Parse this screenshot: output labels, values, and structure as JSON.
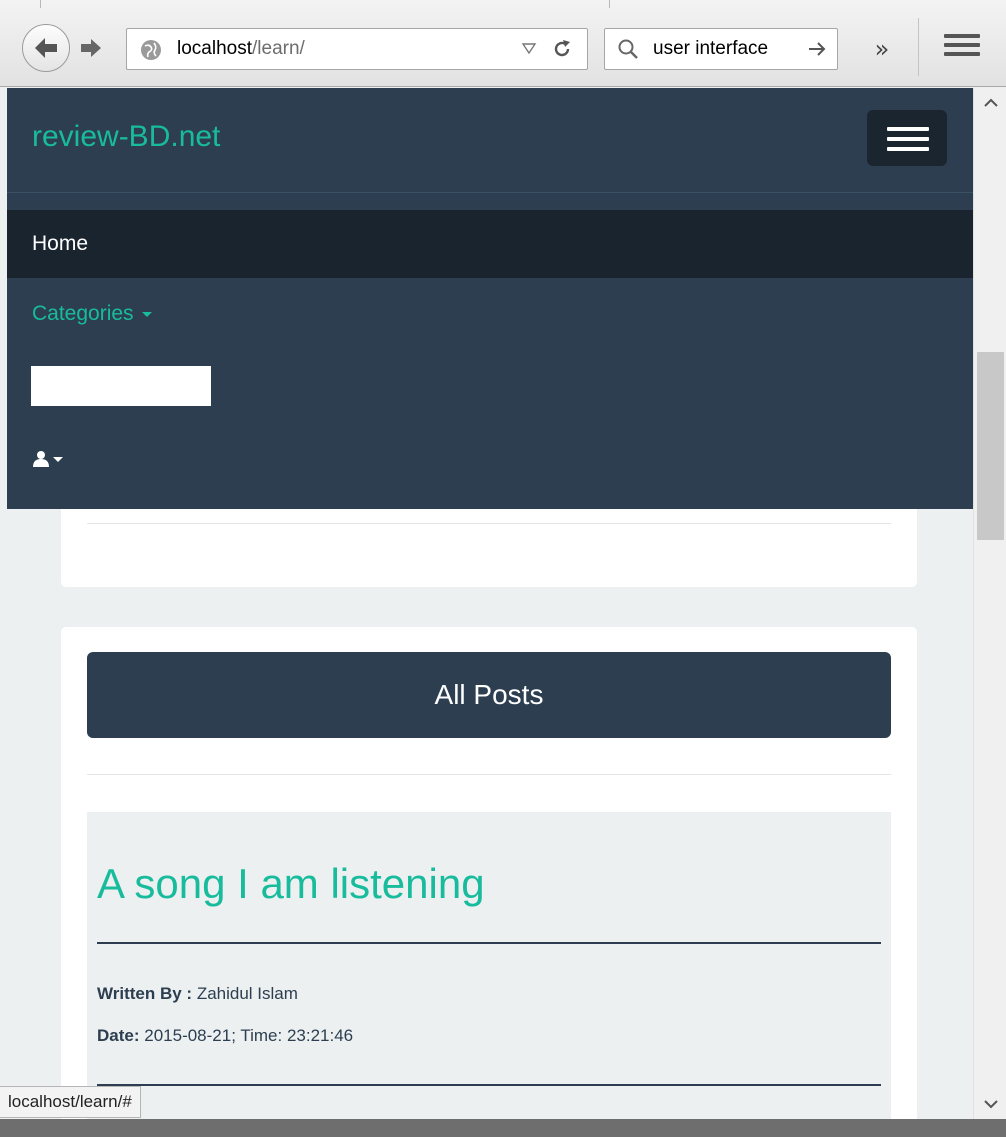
{
  "browser": {
    "url_host": "localhost",
    "url_path": "/learn/",
    "search_text": "user interface",
    "overflow_label": "»",
    "status_url": "localhost/learn/#"
  },
  "navbar": {
    "brand": "review-BD.net",
    "items": [
      {
        "label": "Home",
        "active": true
      },
      {
        "label": "Categories",
        "dropdown": true
      }
    ],
    "search_value": "",
    "user_icon": "user-icon"
  },
  "content": {
    "section_title": "All Posts",
    "posts": [
      {
        "title": "A song I am listening",
        "author_label": "Written By :",
        "author": "Zahidul Islam",
        "date_label": "Date:",
        "date_value": "2015-08-21; Time: 23:21:46"
      }
    ]
  },
  "colors": {
    "navbar_bg": "#2c3e50",
    "navbar_active_bg": "#1a242f",
    "accent": "#18bc9c",
    "page_bg": "#ecf0f1"
  }
}
